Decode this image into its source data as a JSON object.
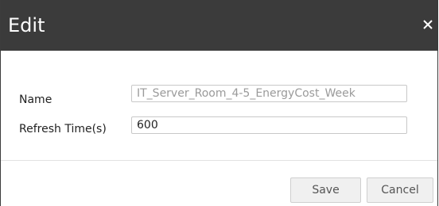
{
  "dialog": {
    "title": "Edit",
    "close_icon": "close-icon"
  },
  "form": {
    "name_label": "Name",
    "name_value": "IT_Server_Room_4-5_EnergyCost_Week",
    "refresh_label": "Refresh Time(s)",
    "refresh_value": "600"
  },
  "footer": {
    "save_label": "Save",
    "cancel_label": "Cancel"
  },
  "colors": {
    "titlebar_bg": "#3b3b3b",
    "title_text": "#ffffff",
    "button_bg": "#f0f0f0"
  }
}
